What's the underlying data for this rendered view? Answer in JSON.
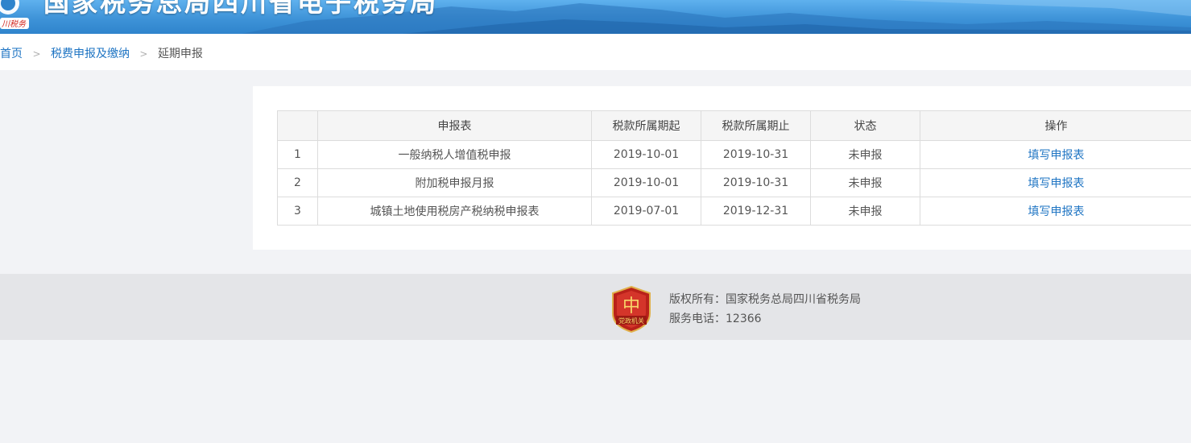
{
  "header": {
    "title": "国家税务总局四川省电子税务局",
    "logo_script": "川税务"
  },
  "breadcrumb": {
    "items": [
      {
        "label": "首页"
      },
      {
        "label": "税费申报及缴纳"
      },
      {
        "label": "延期申报"
      }
    ],
    "separator": ">"
  },
  "table": {
    "columns": [
      "",
      "申报表",
      "税款所属期起",
      "税款所属期止",
      "状态",
      "操作"
    ],
    "rows": [
      {
        "index": "1",
        "form": "一般纳税人增值税申报",
        "period_start": "2019-10-01",
        "period_end": "2019-10-31",
        "status": "未申报",
        "action": "填写申报表"
      },
      {
        "index": "2",
        "form": "附加税申报月报",
        "period_start": "2019-10-01",
        "period_end": "2019-10-31",
        "status": "未申报",
        "action": "填写申报表"
      },
      {
        "index": "3",
        "form": "城镇土地使用税房产税纳税申报表",
        "period_start": "2019-07-01",
        "period_end": "2019-12-31",
        "status": "未申报",
        "action": "填写申报表"
      }
    ]
  },
  "footer": {
    "badge_label": "党政机关",
    "copyright": "版权所有：国家税务总局四川省税务局",
    "hotline": "服务电话：12366"
  },
  "colors": {
    "link": "#1e74c3",
    "banner": "#3e93d8",
    "badge": "#c0261c"
  }
}
